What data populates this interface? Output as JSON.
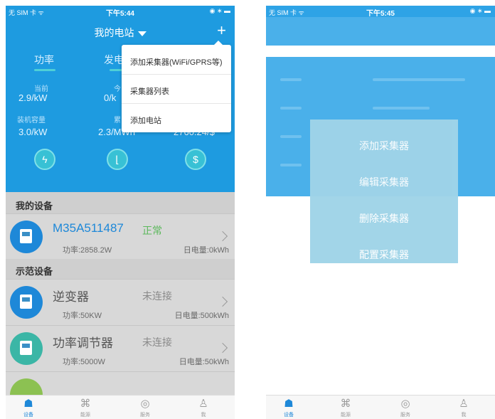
{
  "left": {
    "status": {
      "carrier": "无 SIM 卡 ᯤ",
      "time": "下午5:44",
      "right": "◉ ∗ ▬"
    },
    "nav": {
      "title": "我的电站",
      "plus": "+"
    },
    "tabs": [
      {
        "label": "功率"
      },
      {
        "label": "发电"
      }
    ],
    "stats": {
      "current_label": "当前",
      "current_value": "2.9/kW",
      "today_label": "今",
      "today_value": "0/k",
      "capacity_label": "装机容量",
      "capacity_value": "3.0/kW",
      "total_label": "累",
      "total_value": "2.3/MWh",
      "income_value": "2760.24/$"
    },
    "menu": {
      "items": [
        "添加采集器(WiFi/GPRS等)",
        "采集器列表",
        "添加电站"
      ]
    },
    "sections": {
      "my_devices": "我的设备",
      "demo_devices": "示范设备"
    },
    "devices": [
      {
        "name": "M35A511487",
        "status": "正常",
        "power": "功率:2858.2W",
        "daily": "日电量:0kWh",
        "color": "#1e88d8",
        "status_color": "#5cb85c"
      },
      {
        "name": "逆变器",
        "status": "未连接",
        "power": "功率:50KW",
        "daily": "日电量:500kWh",
        "color": "#1e88d8"
      },
      {
        "name": "功率调节器",
        "status": "未连接",
        "power": "功率:5000W",
        "daily": "日电量:50kWh",
        "color": "#3bb6a6"
      }
    ],
    "tabbar": [
      {
        "label": "设备",
        "icon": "device-tree-icon",
        "glyph": "☗"
      },
      {
        "label": "能源",
        "icon": "energy-icon",
        "glyph": "⌘"
      },
      {
        "label": "服务",
        "icon": "service-icon",
        "glyph": "◎"
      },
      {
        "label": "我",
        "icon": "user-icon",
        "glyph": "♙"
      }
    ]
  },
  "right": {
    "status": {
      "carrier": "无 SIM 卡 ᯤ",
      "time": "下午5:45",
      "right": "◉ ∗ ▬"
    },
    "overlay_menu": [
      "添加采集器",
      "编辑采集器",
      "删除采集器",
      "配置采集器"
    ],
    "tabbar": [
      {
        "label": "设备",
        "icon": "device-tree-icon",
        "glyph": "☗"
      },
      {
        "label": "能源",
        "icon": "energy-icon",
        "glyph": "⌘"
      },
      {
        "label": "服务",
        "icon": "service-icon",
        "glyph": "◎"
      },
      {
        "label": "我",
        "icon": "user-icon",
        "glyph": "♙"
      }
    ]
  }
}
